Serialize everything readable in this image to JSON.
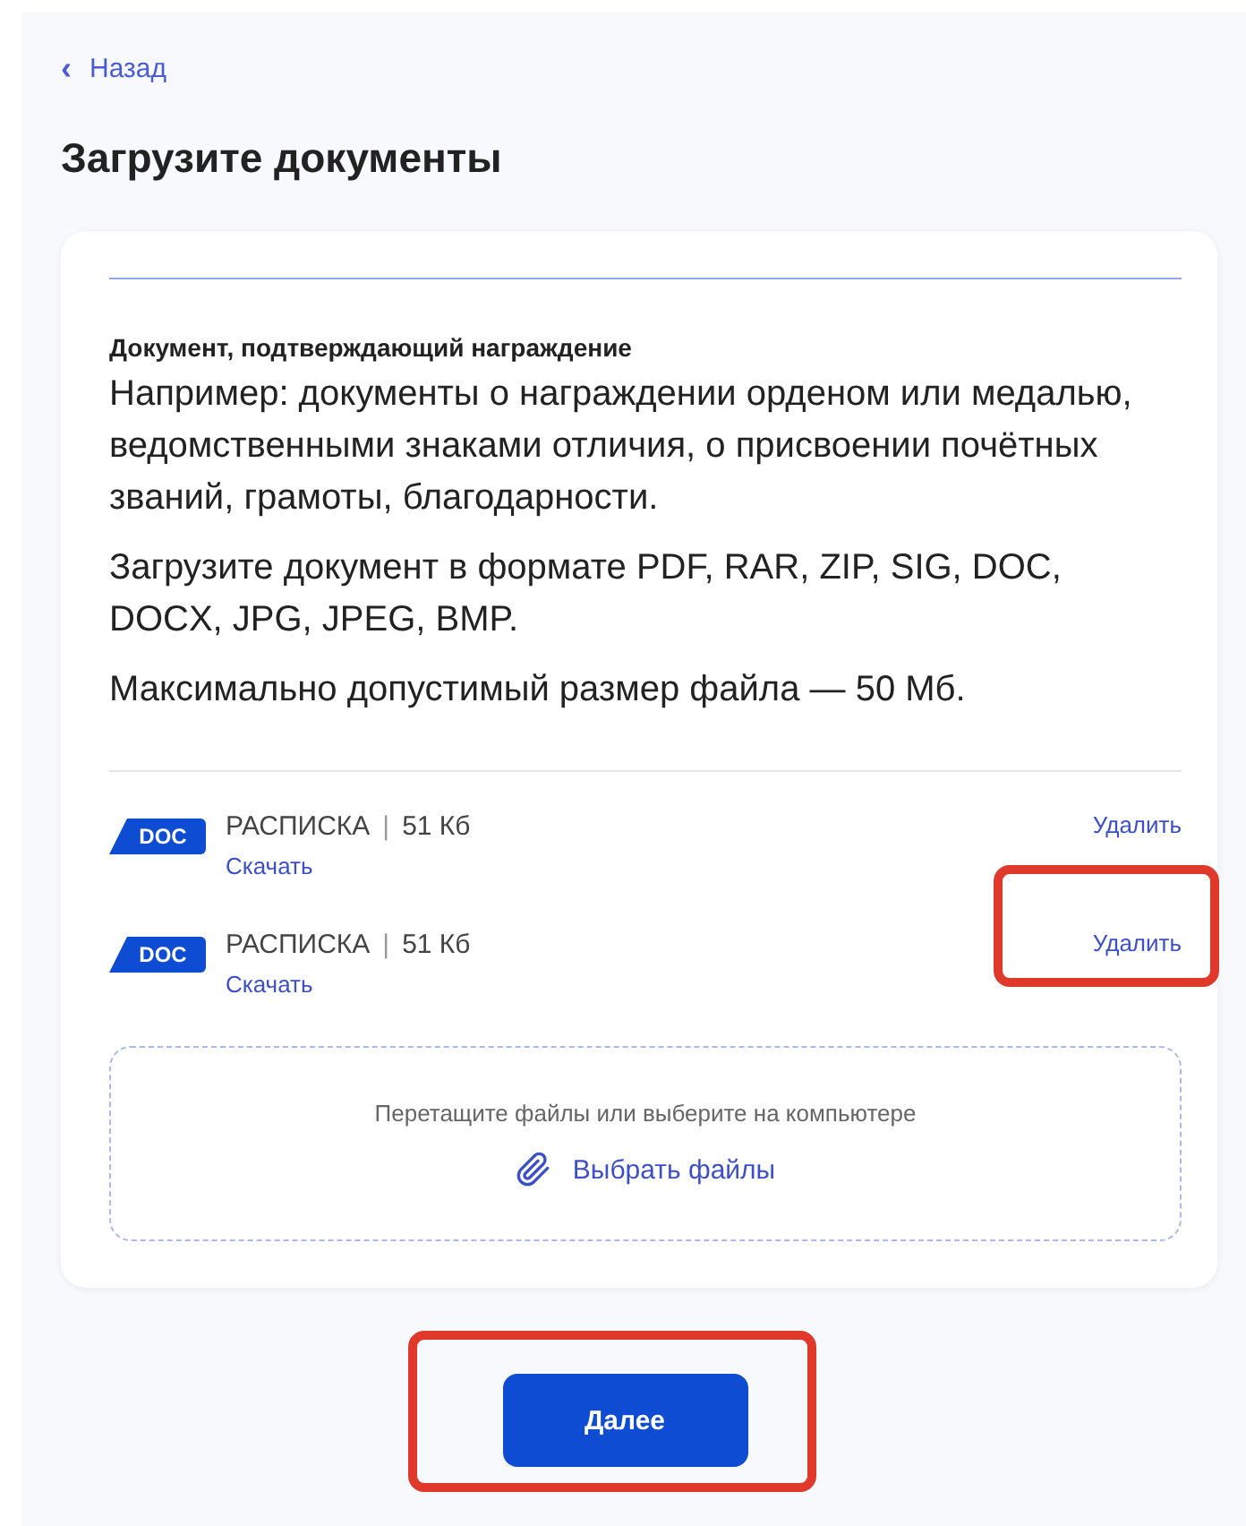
{
  "back_link": {
    "icon": "‹",
    "label": "Назад"
  },
  "title": "Загрузите документы",
  "document": {
    "heading": "Документ, подтверждающий награждение",
    "paragraphs": [
      "Например: документы о награждении орденом или медалью, ведомственными знаками отличия, о присвоении почётных званий, грамоты, благодарности.",
      "Загрузите документ в формате PDF, RAR, ZIP, SIG, DOC, DOCX, JPG, JPEG, BMP.",
      "Максимально допустимый размер файла — 50 Мб."
    ]
  },
  "files": [
    {
      "badge": "DOC",
      "name": "РАСПИСКА",
      "separator": "|",
      "size": "51 Кб",
      "download": "Скачать",
      "delete": "Удалить",
      "highlighted": false
    },
    {
      "badge": "DOC",
      "name": "РАСПИСКА",
      "separator": "|",
      "size": "51 Кб",
      "download": "Скачать",
      "delete": "Удалить",
      "highlighted": true
    }
  ],
  "dropzone": {
    "hint": "Перетащите файлы или выберите на компьютере",
    "button": "Выбрать файлы"
  },
  "next_button": {
    "label": "Далее",
    "highlighted": true
  }
}
